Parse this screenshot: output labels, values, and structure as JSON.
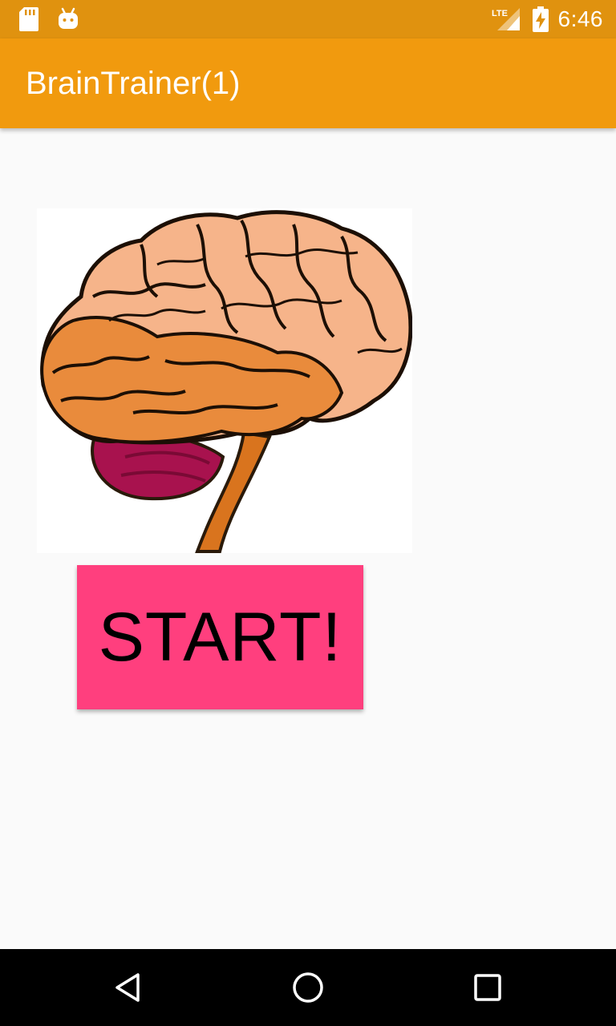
{
  "status_bar": {
    "time": "6:46",
    "network_label": "LTE",
    "icons": [
      "sd-card-icon",
      "android-icon",
      "signal-icon",
      "battery-charging-icon"
    ]
  },
  "app_bar": {
    "title": "BrainTrainer(1)"
  },
  "main": {
    "image_icon": "brain-illustration",
    "start_button_label": "START!"
  },
  "nav_bar": {
    "icons": [
      "back-icon",
      "home-icon",
      "recents-icon"
    ]
  },
  "colors": {
    "status_bar": "#e0920f",
    "app_bar": "#f19a0e",
    "start_button": "#ff3f7e",
    "background": "#fafafa"
  }
}
